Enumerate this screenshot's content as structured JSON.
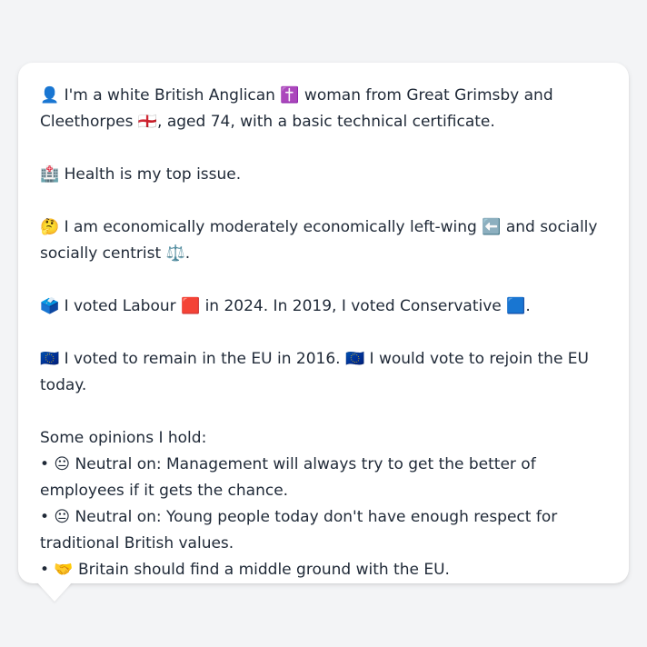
{
  "message": {
    "intro": "👤 I'm a white British Anglican ✝️ woman from Great Grimsby and Cleethorpes 🏴󠁧󠁢󠁥󠁮󠁧󠁿, aged 74, with a basic technical certificate.",
    "health": "🏥 Health is my top issue.",
    "economics": "🤔 I am economically moderately economically left-wing ⬅️ and socially socially centrist ⚖️.",
    "vote": "🗳️ I voted Labour 🟥 in 2024. In 2019, I voted Conservative 🟦.",
    "eu": "🇪🇺 I voted to remain in the EU in 2016. 🇪🇺 I would vote to rejoin the EU today.",
    "opinions_heading": "Some opinions I hold:",
    "opinions": [
      "• 😐 Neutral on: Management will always try to get the better of employees if it gets the chance.",
      "• 😐 Neutral on: Young people today don't have enough respect for traditional British values.",
      "• 🤝 Britain should find a middle ground with the EU."
    ]
  }
}
